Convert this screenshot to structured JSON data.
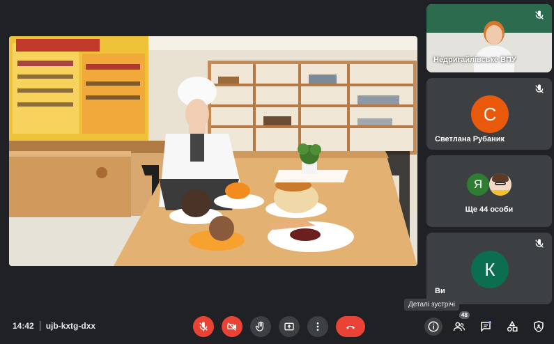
{
  "meeting": {
    "time": "14:42",
    "code": "ujb-kxtg-dxx"
  },
  "tooltip": "Деталі зустрічі",
  "participants": {
    "host": {
      "name": "Недригайлівське ВПУ"
    },
    "svetlana": {
      "name": "Светлана Рубаник",
      "initial": "С",
      "color": "#e8590c"
    },
    "others": {
      "initial": "Я",
      "label": "Ще 44 особи",
      "color": "#2e7d32"
    },
    "you": {
      "name": "Ви",
      "initial": "К",
      "color": "#0b6e4f"
    }
  },
  "people_count": "48",
  "colors": {
    "background": "#202124",
    "tile": "#3c4043",
    "danger": "#ea4335"
  }
}
